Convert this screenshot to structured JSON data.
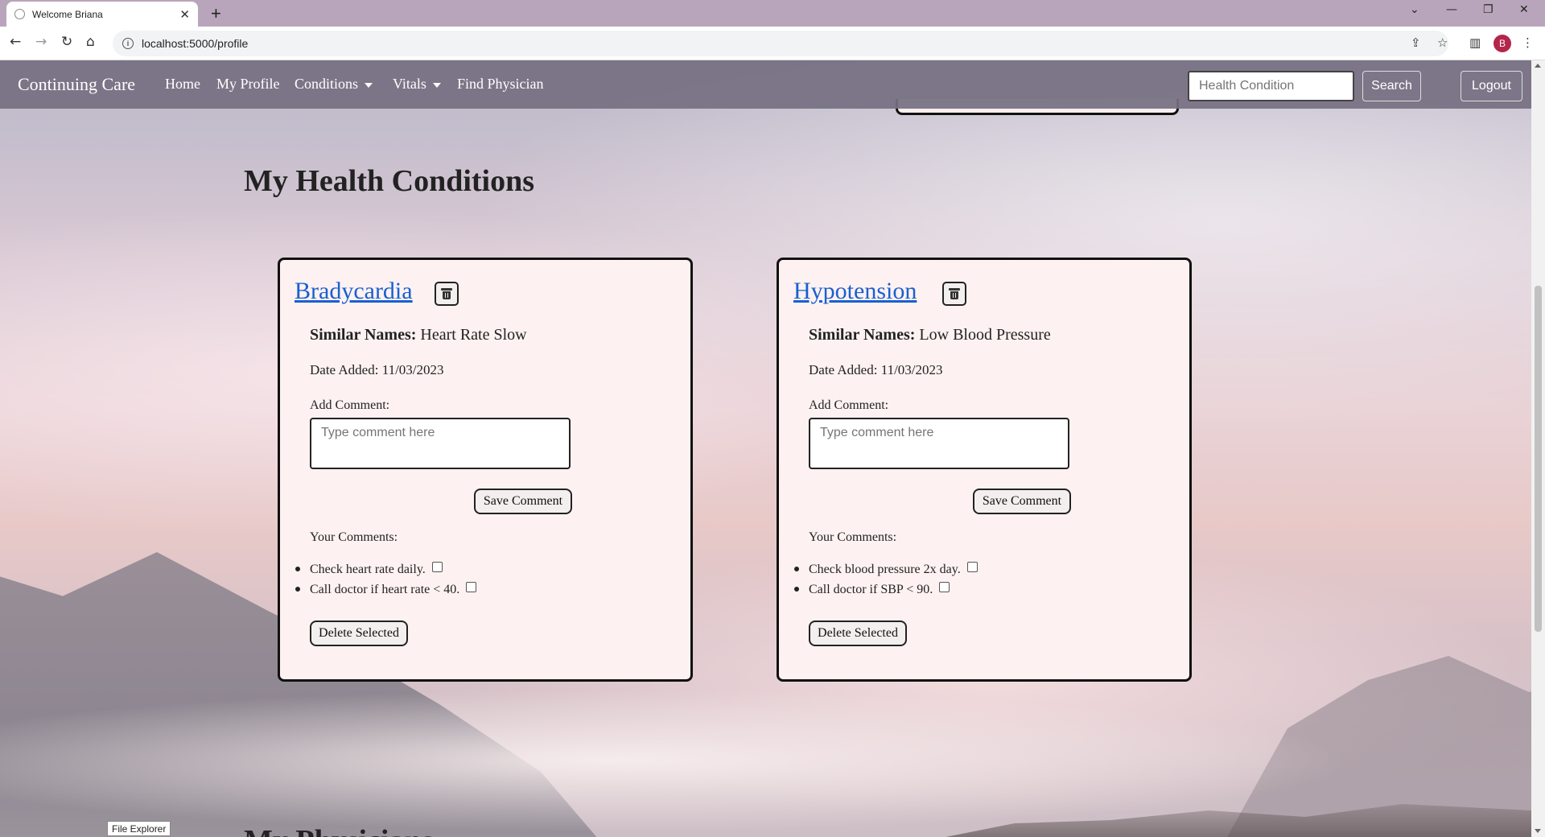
{
  "browser": {
    "tab_title": "Welcome Briana",
    "url": "localhost:5000/profile",
    "profile_initial": "B",
    "tooltip": "File Explorer"
  },
  "nav": {
    "brand": "Continuing Care",
    "links": [
      "Home",
      "My Profile",
      "Conditions",
      "Vitals",
      "Find Physician"
    ],
    "search_placeholder": "Health Condition",
    "search_button": "Search",
    "logout_button": "Logout"
  },
  "page": {
    "section_title": "My Health Conditions",
    "next_section_title": "My Physicians"
  },
  "conditions": [
    {
      "name": "Bradycardia",
      "similar_label": "Similar Names:",
      "similar_value": "Heart Rate Slow",
      "date_added": "Date Added: 11/03/2023",
      "add_comment_label": "Add Comment:",
      "comment_placeholder": "Type comment here",
      "save_button": "Save Comment",
      "your_comments_label": "Your Comments:",
      "comments": [
        "Check heart rate daily.",
        "Call doctor if heart rate < 40."
      ],
      "delete_button": "Delete Selected"
    },
    {
      "name": "Hypotension",
      "similar_label": "Similar Names:",
      "similar_value": "Low Blood Pressure",
      "date_added": "Date Added: 11/03/2023",
      "add_comment_label": "Add Comment:",
      "comment_placeholder": "Type comment here",
      "save_button": "Save Comment",
      "your_comments_label": "Your Comments:",
      "comments": [
        "Check blood pressure 2x day.",
        "Call doctor if SBP < 90."
      ],
      "delete_button": "Delete Selected"
    }
  ],
  "icons": {
    "trash": "trash-icon",
    "back": "back-arrow-icon",
    "forward": "forward-arrow-icon",
    "reload": "reload-icon",
    "home": "home-icon",
    "share": "share-icon",
    "bookmark": "star-icon",
    "sidepanel": "side-panel-icon",
    "menu": "kebab-menu-icon"
  },
  "colors": {
    "nav_bg": "#767082",
    "card_bg": "#fdf2f1",
    "link": "#1a5fd1",
    "tab_strip": "#b9a5bb"
  }
}
